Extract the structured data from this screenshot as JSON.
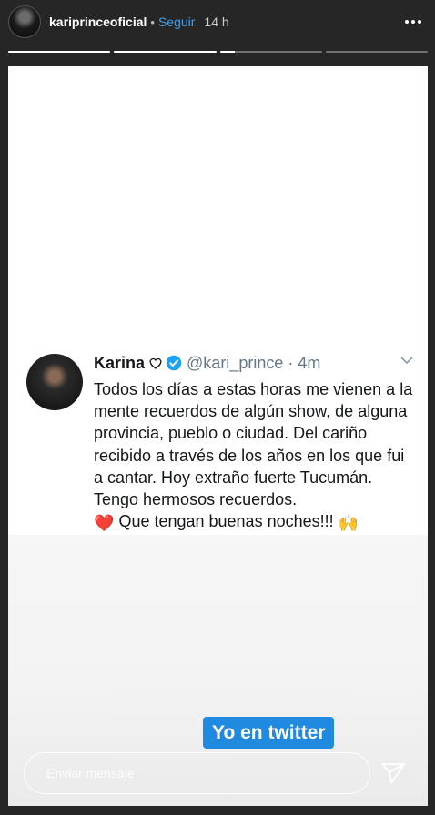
{
  "header": {
    "username": "kariprinceoficial",
    "dot": "•",
    "follow_label": "Seguir",
    "time": "14 h",
    "avatar_icon": "profile-avatar",
    "more_icon": "more-horizontal-icon"
  },
  "progress": {
    "segments_fill": [
      1,
      1,
      0.15,
      0,
      0
    ]
  },
  "tweet": {
    "name": "Karina",
    "handle": "@kari_prince",
    "dot": "·",
    "time": "4m",
    "text_1": "Todos los días a estas horas me vienen a la mente recuerdos de algún show, de alguna provincia, pueblo o ciudad. Del cariño recibido a través de los años en los que fui a cantar. Hoy extraño fuerte Tucumán. Tengo hermosos recuerdos.",
    "text_2": "Que tengan buenas noches!!!",
    "heart_emoji": "❤️",
    "hands_emoji": "🙌",
    "verified_color": "#1da1f2"
  },
  "sticker": {
    "text": "Yo en twitter"
  },
  "reply": {
    "placeholder": "Enviar mensaje",
    "send_icon": "paper-plane-icon"
  },
  "colors": {
    "follow": "#3aa0f0",
    "sticker_bg": "#1f8ae0",
    "background": "#262626"
  }
}
